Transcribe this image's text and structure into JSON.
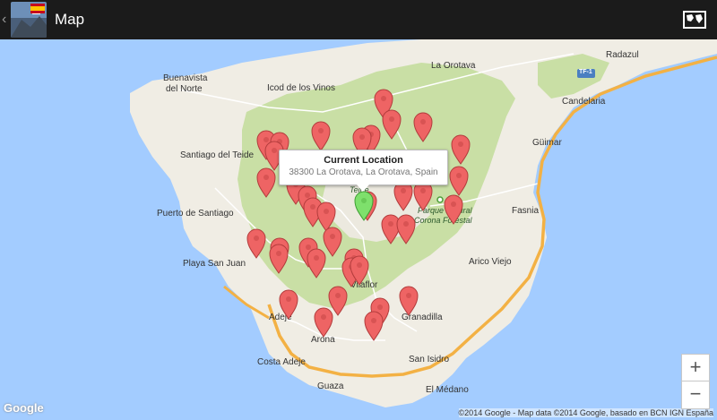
{
  "header": {
    "back_glyph": "‹",
    "title": "Map",
    "layers_icon": "map-layers-icon"
  },
  "map": {
    "places": [
      {
        "text": "La Orotava",
        "name": "place-la-orotava"
      },
      {
        "text": "Radazul",
        "name": "place-radazul"
      },
      {
        "text": "Buenavista",
        "name": "place-buenavista"
      },
      {
        "text": "del Norte",
        "name": "place-del-norte"
      },
      {
        "text": "Icod de los Vinos",
        "name": "place-icod"
      },
      {
        "text": "Candelaria",
        "name": "place-candelaria"
      },
      {
        "text": "Güimar",
        "name": "place-guimar"
      },
      {
        "text": "Santiago del Teide",
        "name": "place-santiago"
      },
      {
        "text": "Puerto de Santiago",
        "name": "place-puerto-santiago"
      },
      {
        "text": "Fasnia",
        "name": "place-fasnia"
      },
      {
        "text": "Playa San Juan",
        "name": "place-playa-san-juan"
      },
      {
        "text": "Arico Viejo",
        "name": "place-arico"
      },
      {
        "text": "Vilaflor",
        "name": "place-vilaflor"
      },
      {
        "text": "Adeje",
        "name": "place-adeje"
      },
      {
        "text": "Granadilla",
        "name": "place-granadilla"
      },
      {
        "text": "Arona",
        "name": "place-arona"
      },
      {
        "text": "Costa Adeje",
        "name": "place-costa-adeje"
      },
      {
        "text": "San Isidro",
        "name": "place-san-isidro"
      },
      {
        "text": "El Médano",
        "name": "place-el-medano"
      },
      {
        "text": "Guaza",
        "name": "place-guaza"
      },
      {
        "text": "Teide",
        "name": "place-teide"
      },
      {
        "text": "Parque Natural",
        "name": "park-label-1"
      },
      {
        "text": "Corona Forestal",
        "name": "park-label-2"
      },
      {
        "text": "TF-1",
        "name": "road-shield-tf1"
      }
    ],
    "popup": {
      "title": "Current Location",
      "subtitle": "38300 La Orotava, La Orotava, Spain"
    },
    "zoom_in": "+",
    "zoom_out": "−",
    "google_logo": "Google",
    "attribution": "©2014 Google - Map data ©2014 Google, basado en BCN IGN España",
    "colors": {
      "sea": "#a3ccff",
      "land": "#f0ede4",
      "park": "#c9dfa5",
      "highway": "#f3b144",
      "pin": "#ee6464",
      "current_pin": "#7ee06c"
    }
  }
}
